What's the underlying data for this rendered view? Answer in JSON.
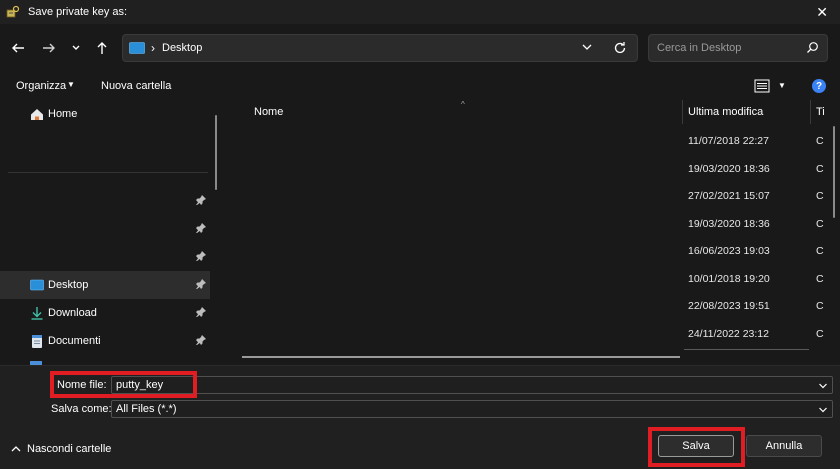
{
  "window": {
    "title": "Save private key as:",
    "close_glyph": "✕"
  },
  "navbar": {
    "back_icon": "arrow-left-icon",
    "forward_icon": "arrow-right-icon",
    "recent_icon": "chevron-down-icon",
    "up_icon": "arrow-up-icon",
    "breadcrumb_sep": "›",
    "path": "Desktop",
    "search_placeholder": "Cerca in Desktop"
  },
  "toolbar": {
    "organize_label": "Organizza",
    "new_folder_label": "Nuova cartella",
    "help_label": "?"
  },
  "nav_pane": {
    "home_label": "Home",
    "items": [
      {
        "label": "Desktop",
        "icon": "desktop-icon"
      },
      {
        "label": "Download",
        "icon": "download-icon"
      },
      {
        "label": "Documenti",
        "icon": "document-icon"
      }
    ]
  },
  "file_list": {
    "columns": {
      "name": "Nome",
      "modified": "Ultima modifica",
      "type": "Ti"
    },
    "rows": [
      {
        "modified": "11/07/2018 22:27",
        "type": "C"
      },
      {
        "modified": "19/03/2020 18:36",
        "type": "C"
      },
      {
        "modified": "27/02/2021 15:07",
        "type": "C"
      },
      {
        "modified": "19/03/2020 18:36",
        "type": "C"
      },
      {
        "modified": "16/06/2023 19:03",
        "type": "C"
      },
      {
        "modified": "10/01/2018 19:20",
        "type": "C"
      },
      {
        "modified": "22/08/2023 19:51",
        "type": "C"
      },
      {
        "modified": "24/11/2022 23:12",
        "type": "C"
      }
    ]
  },
  "form": {
    "filename_label": "Nome file:",
    "filename_value": "putty_key",
    "savetype_label": "Salva come:",
    "savetype_value": "All Files (*.*)",
    "hide_folders_label": "Nascondi cartelle",
    "save_label": "Salva",
    "cancel_label": "Annulla"
  },
  "colors": {
    "highlight": "#e11d24",
    "accent": "#3b82f6"
  }
}
